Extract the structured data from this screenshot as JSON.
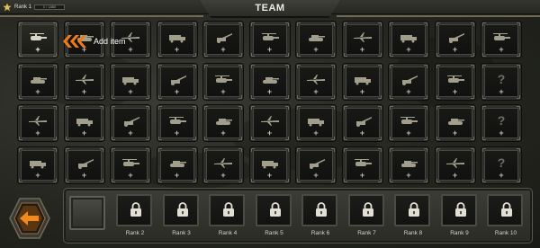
{
  "header": {
    "rank_label": "Rank 1",
    "xp_text": "0 / 1880",
    "title": "TEAM"
  },
  "hint": {
    "add_item_label": "Add item"
  },
  "grid": {
    "rows": [
      [
        {
          "icon": "infantry-icon",
          "state": "active"
        },
        {
          "icon": "light-helicopter-icon"
        },
        {
          "icon": "helicopter-icon"
        },
        {
          "icon": "scout-helicopter-icon"
        },
        {
          "icon": "attack-helicopter-icon"
        },
        {
          "icon": "vehicle-group-icon"
        },
        {
          "icon": "apc-group-icon"
        },
        {
          "icon": "convoy-icon"
        },
        {
          "icon": "artillery-group-icon"
        },
        {
          "icon": "armored-car-icon"
        },
        {
          "icon": "aircraft-icon"
        }
      ],
      [
        {
          "icon": "rifle-icon"
        },
        {
          "icon": "rocket-launcher-icon"
        },
        {
          "icon": "howitzer-icon"
        },
        {
          "icon": "field-gun-icon"
        },
        {
          "icon": "heavy-artillery-icon"
        },
        {
          "icon": "scout-car-icon"
        },
        {
          "icon": "armored-vehicle-icon"
        },
        {
          "icon": "tracked-apc-icon"
        },
        {
          "icon": "cannon-icon"
        },
        {
          "icon": "mortar-icon"
        },
        {
          "icon": "unknown-icon",
          "locked": true
        }
      ],
      [
        {
          "icon": "light-tank-icon"
        },
        {
          "icon": "medium-tank-icon"
        },
        {
          "icon": "heavy-tank-icon"
        },
        {
          "icon": "self-propelled-gun-icon"
        },
        {
          "icon": "main-battle-tank-icon"
        },
        {
          "icon": "gunship-icon"
        },
        {
          "icon": "heavy-helicopter-icon"
        },
        {
          "icon": "transport-helicopter-icon"
        },
        {
          "icon": "chinook-helicopter-icon"
        },
        {
          "icon": "helicopter-squadron-icon"
        },
        {
          "icon": "unknown-icon",
          "locked": true
        }
      ],
      [
        {
          "icon": "fighter-jet-icon"
        },
        {
          "icon": "interceptor-icon"
        },
        {
          "icon": "bomber-icon"
        },
        {
          "icon": "stealth-bomber-icon"
        },
        {
          "icon": "jet-squadron-icon"
        },
        {
          "icon": "missile-launcher-icon"
        },
        {
          "icon": "sam-launcher-icon"
        },
        {
          "icon": "radar-mast-icon"
        },
        {
          "icon": "ballistic-missile-icon"
        },
        {
          "icon": "missile-truck-icon"
        },
        {
          "icon": "unknown-icon",
          "locked": true
        }
      ]
    ],
    "plus_symbol": "+",
    "locked_symbol": "?"
  },
  "ranks": [
    {
      "label": "Rank 2"
    },
    {
      "label": "Rank 3"
    },
    {
      "label": "Rank 4"
    },
    {
      "label": "Rank 5"
    },
    {
      "label": "Rank 6"
    },
    {
      "label": "Rank 7"
    },
    {
      "label": "Rank 8"
    },
    {
      "label": "Rank 9"
    },
    {
      "label": "Rank 10"
    }
  ],
  "colors": {
    "accent_orange": "#f07a1a",
    "frame": "#2e2f2a",
    "text_light": "#ecebe3"
  }
}
